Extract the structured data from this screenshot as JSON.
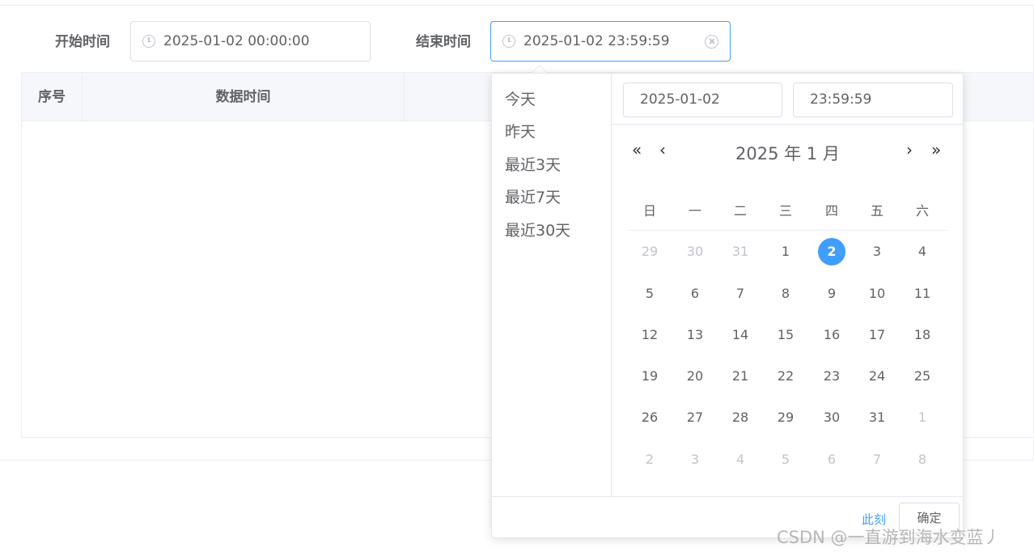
{
  "filter": {
    "start_label": "开始时间",
    "start_value": "2025-01-02 00:00:00",
    "end_label": "结束时间",
    "end_value": "2025-01-02 23:59:59"
  },
  "table": {
    "columns": [
      "序号",
      "数据时间"
    ]
  },
  "picker": {
    "shortcuts": [
      "今天",
      "昨天",
      "最近3天",
      "最近7天",
      "最近30天"
    ],
    "date_input": "2025-01-02",
    "time_input": "23:59:59",
    "header": "2025 年  1 月",
    "nav": {
      "prev_year": "«",
      "prev_month": "‹",
      "next_month": "›",
      "next_year": "»"
    },
    "weekdays": [
      "日",
      "一",
      "二",
      "三",
      "四",
      "五",
      "六"
    ],
    "days": [
      [
        "29",
        "30",
        "31",
        "1",
        "2",
        "3",
        "4"
      ],
      [
        "5",
        "6",
        "7",
        "8",
        "9",
        "10",
        "11"
      ],
      [
        "12",
        "13",
        "14",
        "15",
        "16",
        "17",
        "18"
      ],
      [
        "19",
        "20",
        "21",
        "22",
        "23",
        "24",
        "25"
      ],
      [
        "26",
        "27",
        "28",
        "29",
        "30",
        "31",
        "1"
      ],
      [
        "2",
        "3",
        "4",
        "5",
        "6",
        "7",
        "8"
      ]
    ],
    "selected_day": "2",
    "now_label": "此刻",
    "ok_label": "确定"
  },
  "watermark": "CSDN @一直游到海水变蓝丿",
  "colors": {
    "accent": "#409eff",
    "border": "#dcdfe6",
    "muted": "#c0c4cc"
  }
}
